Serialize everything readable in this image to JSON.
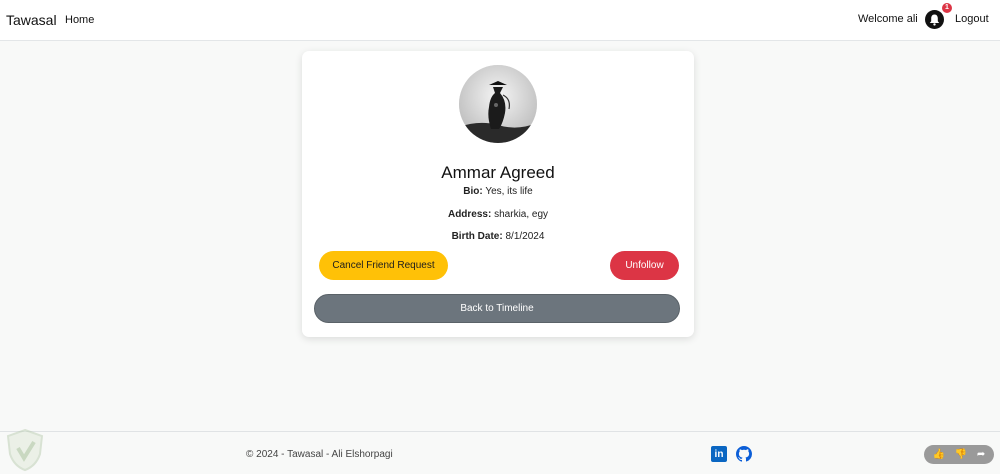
{
  "navbar": {
    "brand": "Tawasal",
    "home": "Home",
    "welcome": "Welcome ali",
    "notification_count": "1",
    "logout": "Logout"
  },
  "profile": {
    "name": "Ammar Agreed",
    "bio_label": "Bio:",
    "bio": "Yes, its life",
    "address_label": "Address:",
    "address": "sharkia, egy",
    "birth_label": "Birth Date:",
    "birth_date": "8/1/2024"
  },
  "actions": {
    "cancel_request": "Cancel Friend Request",
    "unfollow": "Unfollow",
    "back": "Back to Timeline"
  },
  "footer": {
    "copyright": "© 2024 - Tawasal - Ali Elshorpagi"
  },
  "colors": {
    "warning": "#ffc107",
    "danger": "#dc3545",
    "secondary": "#6c757d"
  }
}
